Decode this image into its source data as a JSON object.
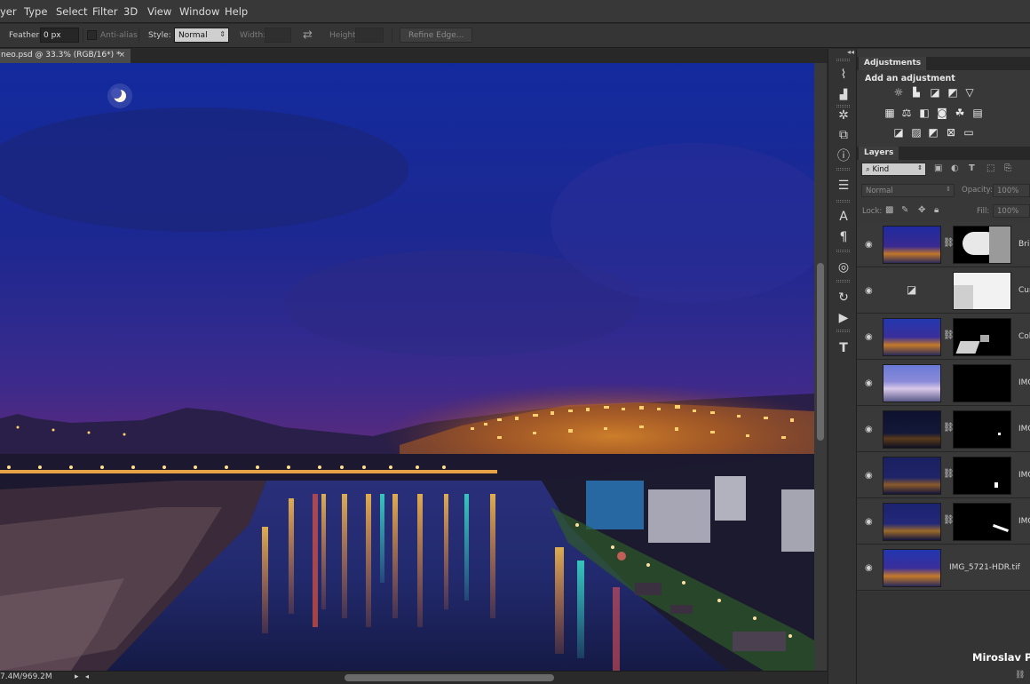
{
  "menu": {
    "items": [
      "yer",
      "Type",
      "Select",
      "Filter",
      "3D",
      "View",
      "Window",
      "Help"
    ]
  },
  "options": {
    "feather_label": "Feather:",
    "feather_value": "0 px",
    "antialias_label": "Anti-alias",
    "style_label": "Style:",
    "style_value": "Normal",
    "width_label": "Width:",
    "height_label": "Height:",
    "refine_edge_label": "Refine Edge..."
  },
  "document": {
    "tab_title": "neo.psd @ 33.3% (RGB/16*) *",
    "status_text": "7.4M/969.2M"
  },
  "adjustments": {
    "tab_label": "Adjustments",
    "title": "Add an adjustment",
    "icons": [
      [
        "brightness-contrast-icon",
        "levels-icon",
        "curves-icon",
        "exposure-icon",
        "vibrance-icon"
      ],
      [
        "hue-saturation-icon",
        "color-balance-icon",
        "black-white-icon",
        "photo-filter-icon",
        "channel-mixer-icon",
        "color-lookup-icon"
      ],
      [
        "invert-icon",
        "posterize-icon",
        "threshold-icon",
        "selective-color-icon",
        "gradient-map-icon"
      ]
    ]
  },
  "layers": {
    "tab_label": "Layers",
    "filter_label": "Kind",
    "blend_mode": "Normal",
    "opacity_label": "Opacity:",
    "opacity_value": "100%",
    "lock_label": "Lock:",
    "fill_label": "Fill:",
    "fill_value": "100%",
    "items": [
      {
        "name": "Bri",
        "type": "adjustment"
      },
      {
        "name": "Cur",
        "type": "adjustment"
      },
      {
        "name": "Col",
        "type": "adjustment"
      },
      {
        "name": "IMG",
        "type": "image"
      },
      {
        "name": "IMG",
        "type": "image"
      },
      {
        "name": "IMG",
        "type": "image"
      },
      {
        "name": "IMG",
        "type": "image"
      },
      {
        "name": "IMG_5721-HDR.tif",
        "type": "background"
      }
    ]
  },
  "watermark": "Miroslav Petr"
}
